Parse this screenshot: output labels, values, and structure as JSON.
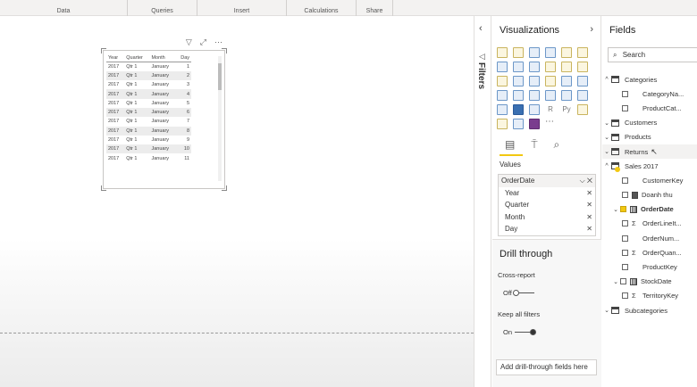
{
  "ribbon": {
    "groups": [
      {
        "label": "Data",
        "width": 143
      },
      {
        "label": "Queries",
        "width": 78
      },
      {
        "label": "Insert",
        "width": 100
      },
      {
        "label": "Calculations",
        "width": 78
      },
      {
        "label": "Share",
        "width": 41
      }
    ]
  },
  "matrix": {
    "headers": [
      "Year",
      "Quarter",
      "Month",
      "Day"
    ],
    "rows": [
      [
        "2017",
        "Qtr 1",
        "January",
        "1"
      ],
      [
        "2017",
        "Qtr 1",
        "January",
        "2"
      ],
      [
        "2017",
        "Qtr 1",
        "January",
        "3"
      ],
      [
        "2017",
        "Qtr 1",
        "January",
        "4"
      ],
      [
        "2017",
        "Qtr 1",
        "January",
        "5"
      ],
      [
        "2017",
        "Qtr 1",
        "January",
        "6"
      ],
      [
        "2017",
        "Qtr 1",
        "January",
        "7"
      ],
      [
        "2017",
        "Qtr 1",
        "January",
        "8"
      ],
      [
        "2017",
        "Qtr 1",
        "January",
        "9"
      ],
      [
        "2017",
        "Qtr 1",
        "January",
        "10"
      ],
      [
        "2017",
        "Qtr 1",
        "January",
        "11"
      ]
    ]
  },
  "filters": {
    "label": "Filters"
  },
  "visualizations": {
    "title": "Visualizations",
    "values_label": "Values",
    "well": {
      "field": "OrderDate",
      "items": [
        "Year",
        "Quarter",
        "Month",
        "Day"
      ]
    },
    "drill": {
      "title": "Drill through",
      "cross_report": "Cross-report",
      "cross_report_state": "Off",
      "keep_filters": "Keep all filters",
      "keep_filters_state": "On",
      "add_fields": "Add drill-through fields here"
    }
  },
  "fields": {
    "title": "Fields",
    "search_placeholder": "Search",
    "tables": {
      "categories": "Categories",
      "categories_cols": [
        "CategoryNa...",
        "ProductCat..."
      ],
      "customers": "Customers",
      "products": "Products",
      "returns": "Returns",
      "sales": "Sales 2017",
      "sales_cols": {
        "customerkey": "CustomerKey",
        "doanh_thu": "Doanh thu",
        "orderdate": "OrderDate",
        "orderline": "OrderLineIt...",
        "ordernum": "OrderNum...",
        "orderquan": "OrderQuan...",
        "productkey": "ProductKey",
        "stockdate": "StockDate",
        "territory": "TerritoryKey"
      },
      "subcategories": "Subcategories"
    }
  }
}
